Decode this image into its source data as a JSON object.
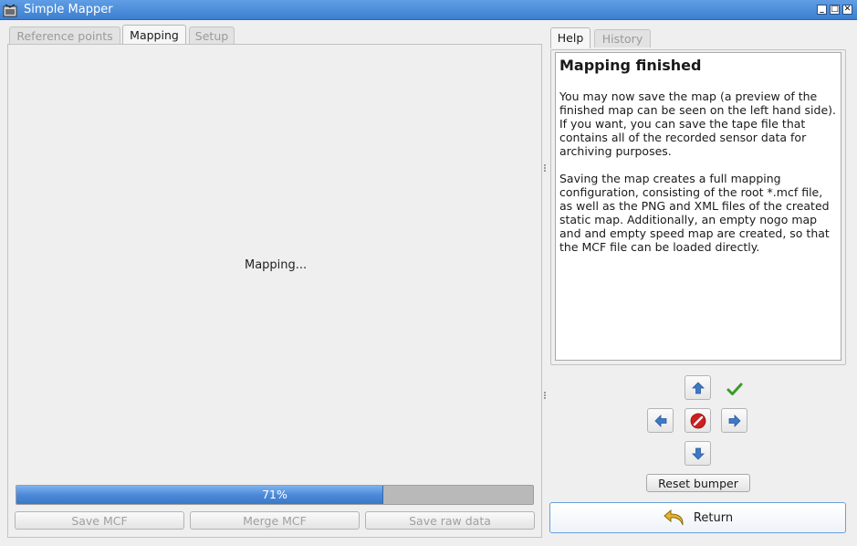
{
  "window": {
    "title": "Simple Mapper",
    "controls": {
      "minimize": "_",
      "maximize": "□",
      "close": "✕"
    }
  },
  "left_tabs": [
    {
      "label": "Reference points",
      "active": false
    },
    {
      "label": "Mapping",
      "active": true
    },
    {
      "label": "Setup",
      "active": false
    }
  ],
  "mapping": {
    "status_text": "Mapping...",
    "progress_percent": 71,
    "progress_label": "71%"
  },
  "buttons": {
    "save_mcf": "Save MCF",
    "merge_mcf": "Merge MCF",
    "save_raw_data": "Save raw data",
    "reset_bumper": "Reset bumper",
    "return": "Return"
  },
  "right_tabs": [
    {
      "label": "Help",
      "active": true
    },
    {
      "label": "History",
      "active": false
    }
  ],
  "help": {
    "title": "Mapping finished",
    "paragraphs": [
      "You may now save the map (a preview of the finished map can be seen on the left hand side). If you want, you can save the tape file that contains all of the recorded sensor data for archiving purposes.",
      "Saving the map creates a full mapping configuration, consisting of the root *.mcf file, as well as the PNG and XML files of the created static map. Additionally, an empty nogo map and and empty speed map are created, so that the MCF file can be loaded directly."
    ]
  },
  "colors": {
    "titlebar": "#4a8ad9",
    "progress_fill": "#4c8ad9",
    "arrow_blue": "#3c79c9",
    "stop_red": "#cc1f1f",
    "check_green": "#3c9a2b",
    "return_icon": "#e8b32a"
  },
  "icons": {
    "app": "app-icon",
    "up": "arrow-up-icon",
    "down": "arrow-down-icon",
    "left": "arrow-left-icon",
    "right": "arrow-right-icon",
    "stop": "stop-icon",
    "check": "checkmark-icon",
    "return": "return-arrow-icon"
  }
}
